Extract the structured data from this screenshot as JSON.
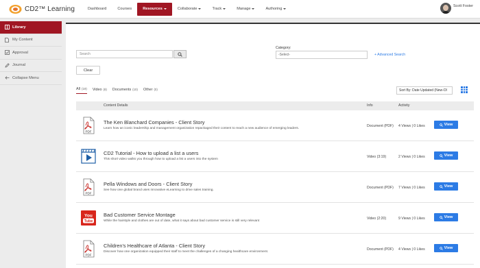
{
  "app": {
    "logo_text": "CD2™ Learning",
    "brand_color": "#a01623",
    "accent_color": "#2c7be5"
  },
  "nav": {
    "items": [
      {
        "label": "Dashboard",
        "has_caret": false,
        "active": false
      },
      {
        "label": "Courses",
        "has_caret": false,
        "active": false
      },
      {
        "label": "Resources",
        "has_caret": true,
        "active": true
      },
      {
        "label": "Collaborate",
        "has_caret": true,
        "active": false
      },
      {
        "label": "Track",
        "has_caret": true,
        "active": false
      },
      {
        "label": "Manage",
        "has_caret": true,
        "active": false
      },
      {
        "label": "Authoring",
        "has_caret": true,
        "active": false
      }
    ],
    "user_name": "Scott Foster"
  },
  "sidebar": {
    "items": [
      {
        "label": "Library",
        "icon": "book-icon",
        "active": true
      },
      {
        "label": "My Content",
        "icon": "document-icon",
        "active": false
      },
      {
        "label": "Approval",
        "icon": "checkbox-icon",
        "active": false
      },
      {
        "label": "Journal",
        "icon": "pencil-icon",
        "active": false
      },
      {
        "label": "Collapse Menu",
        "icon": "collapse-arrow-icon",
        "active": false
      }
    ]
  },
  "search": {
    "placeholder": "Search",
    "clear_label": "Clear",
    "category_label": "Category:",
    "category_value": "-Select-",
    "advanced_label": "+ Advanced Search"
  },
  "filters": {
    "tabs": [
      {
        "label": "All",
        "count": "(19)",
        "active": true
      },
      {
        "label": "Video",
        "count": "(8)",
        "active": false
      },
      {
        "label": "Documents",
        "count": "(10)",
        "active": false
      },
      {
        "label": "Other",
        "count": "(0)",
        "active": false
      }
    ],
    "sort_value": "Sort By: Date Updated (New-Ol"
  },
  "table": {
    "headers": {
      "details": "Content Details",
      "info": "Info",
      "activity": "Activity"
    },
    "view_label": "View",
    "rows": [
      {
        "icon": "pdf-icon",
        "title": "The Ken Blanchard Companies - Client Story",
        "description": "Learn how an iconic leadership and management organization repackaged their content to reach a new audience of emerging leaders.",
        "info": "Document (PDF)",
        "activity": "4 Views | 0 Likes"
      },
      {
        "icon": "video-icon",
        "title": "CD2 Tutorial - How to upload a list a users",
        "description": "This short video walks you through how to upload a list a users into the system",
        "info": "Video (3:19)",
        "activity": "2 Views | 0 Likes"
      },
      {
        "icon": "pdf-icon",
        "title": "Pella Windows and Doors - Client Story",
        "description": "See how one global brand uses innovative eLearning to drive sales training.",
        "info": "Document (PDF)",
        "activity": "7 Views | 0 Likes"
      },
      {
        "icon": "youtube-icon",
        "title": "Bad Customer Service Montage",
        "description": "While the hairstyle and clothes are out of date, what it says about bad customer service is still very relevant",
        "info": "Video (2:20)",
        "activity": "9 Views | 0 Likes"
      },
      {
        "icon": "pdf-icon",
        "title": "Children's Healthcare of Atlanta - Client Story",
        "description": "Discover how one organization equipped their staff to meet the challenges of a changing healthcare environment.",
        "info": "Document (PDF)",
        "activity": "4 Views | 0 Likes"
      }
    ]
  },
  "icon_text": {
    "pdf": "PDF",
    "youtube_top": "You",
    "youtube_bottom": "Tube"
  }
}
